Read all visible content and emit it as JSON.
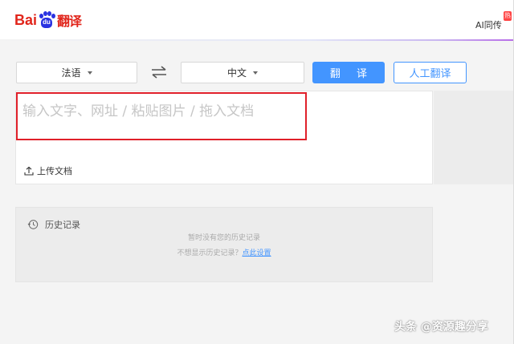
{
  "header": {
    "logo": {
      "bai": "Bai",
      "du": "du",
      "fanyi": "翻译"
    },
    "ai_link": "AI同传",
    "hot_badge": "热"
  },
  "toolbar": {
    "source_lang": "法语",
    "target_lang": "中文",
    "translate_button": "翻 译",
    "human_translate_button": "人工翻译"
  },
  "input": {
    "placeholder": "输入文字、网址 / 粘贴图片 / 拖入文档",
    "upload_label": "上传文档"
  },
  "history": {
    "title": "历史记录",
    "empty_text": "暂时没有您的历史记录",
    "hint_prefix": "不想显示历史记录？",
    "hint_link": "点此设置"
  },
  "watermark": "头条 @资源趣分享",
  "colors": {
    "brand_red": "#e1251b",
    "brand_blue": "#2932e1",
    "accent": "#4395ff",
    "highlight": "#e0202a"
  }
}
